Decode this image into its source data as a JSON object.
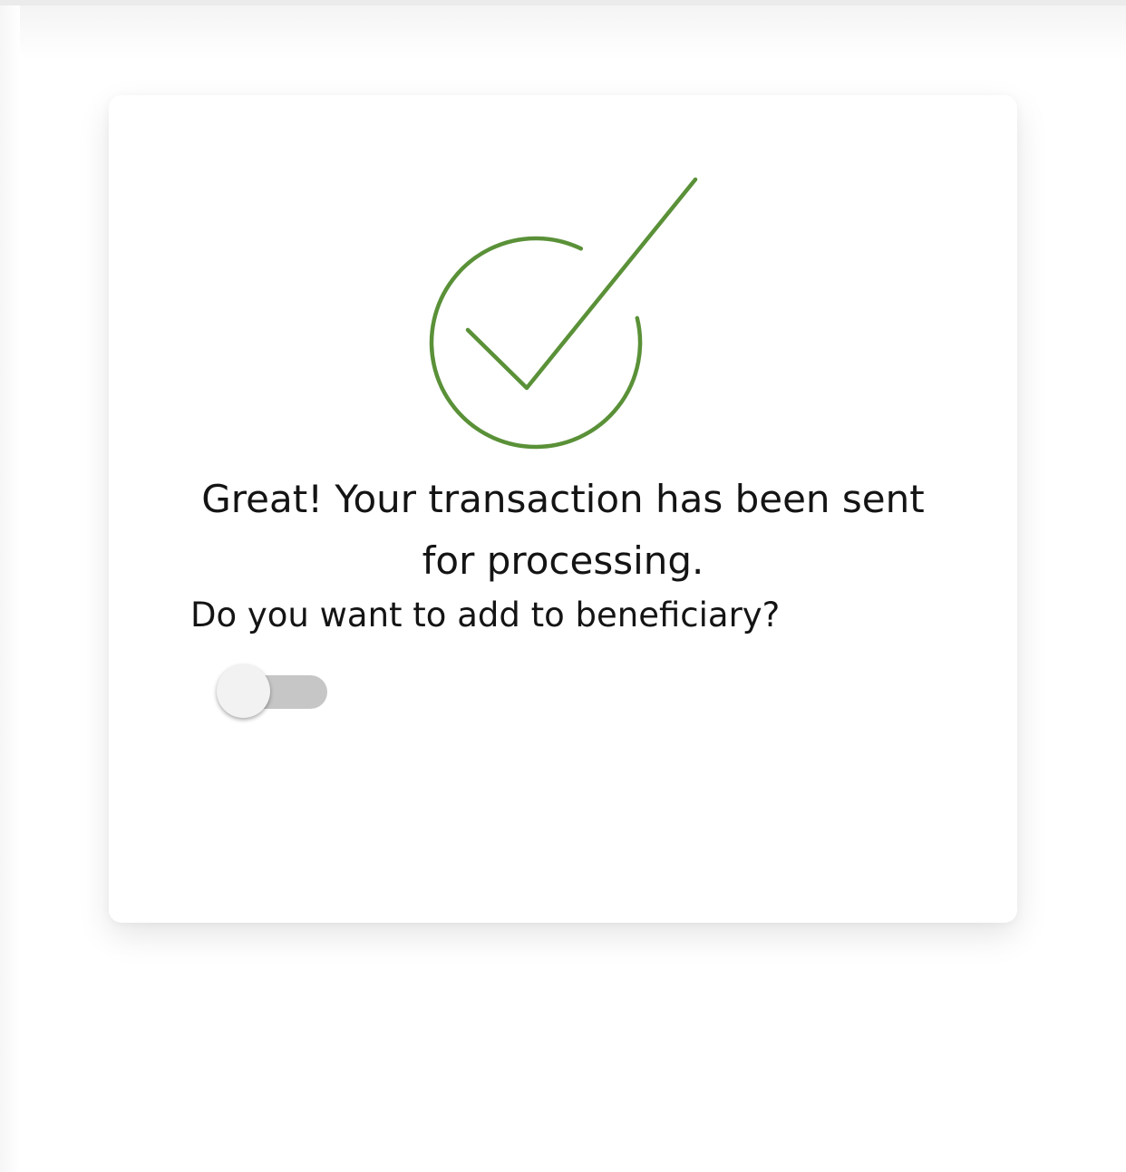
{
  "confirmation": {
    "icon": "check-circle-icon",
    "accent_color": "#5a9138",
    "message": "Great! Your transaction has been sent for processing.",
    "question": "Do you want to add to beneficiary?"
  },
  "beneficiary_toggle": {
    "state": "off",
    "track_color": "#c6c6c6",
    "thumb_color": "#f2f2f2"
  }
}
